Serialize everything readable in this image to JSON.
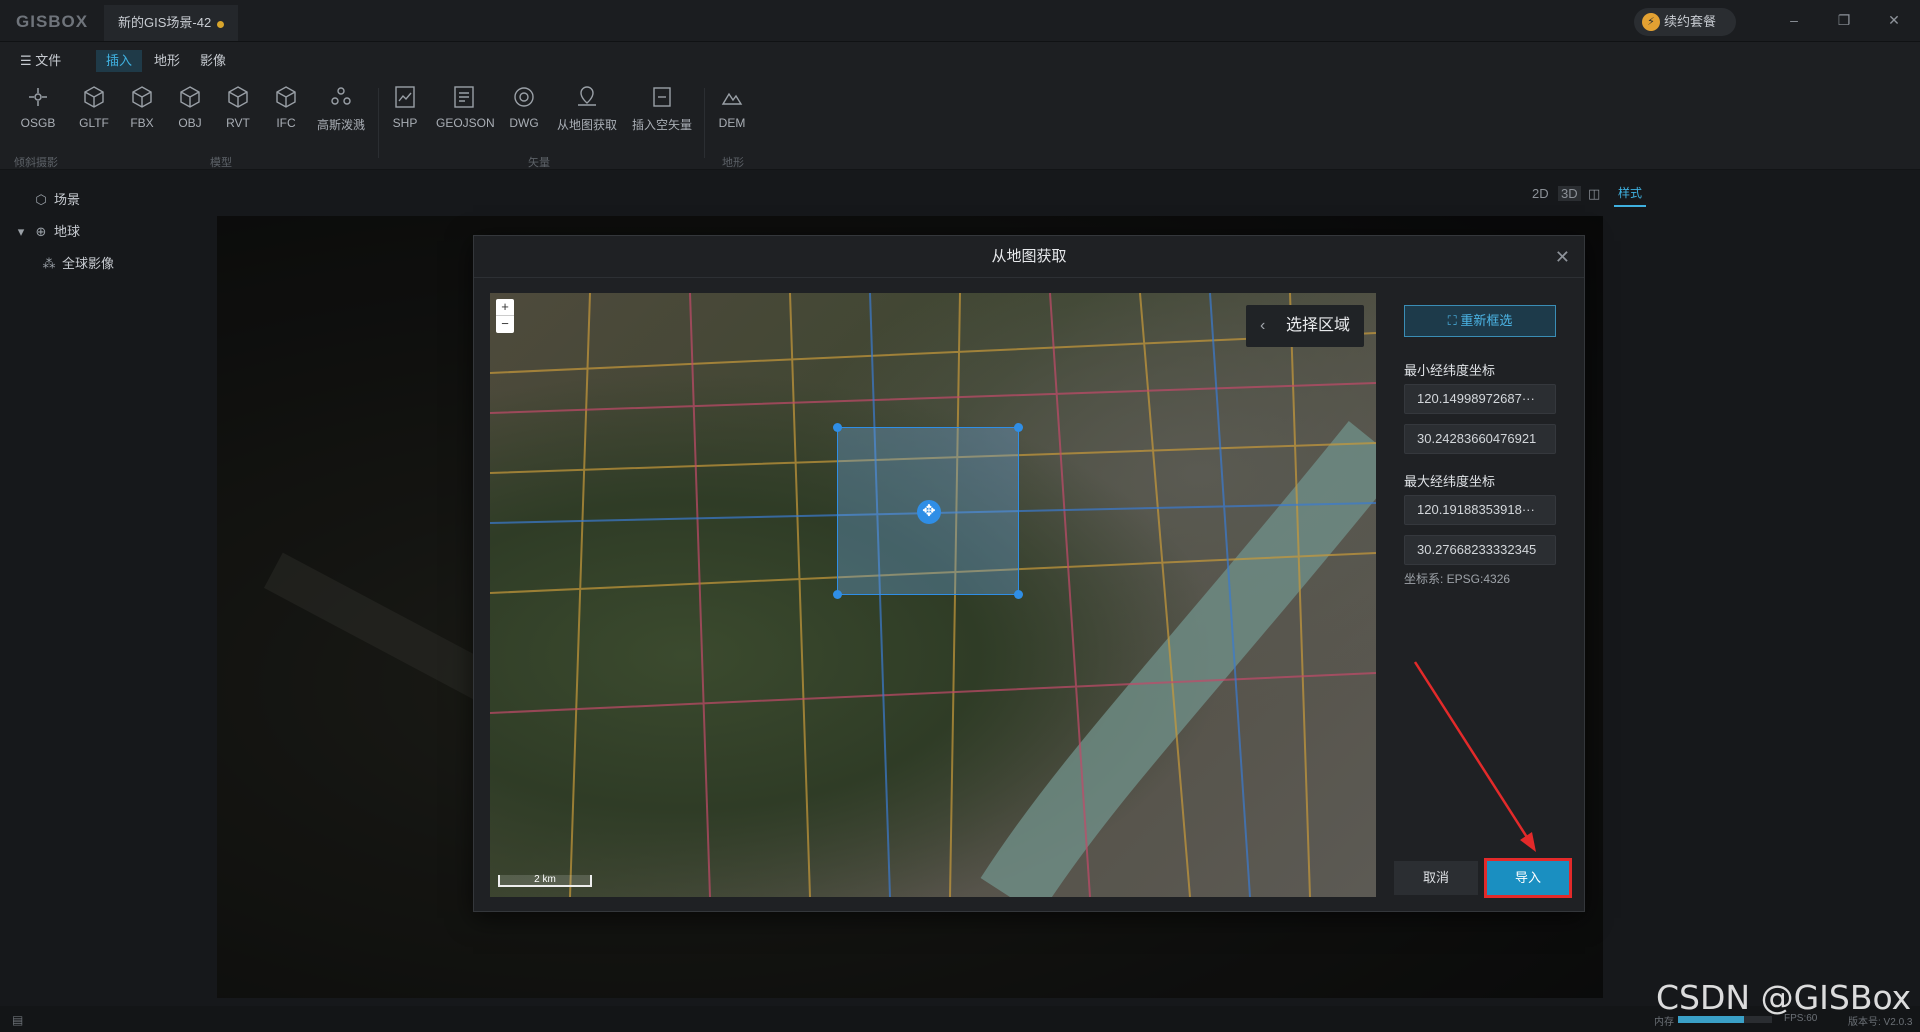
{
  "app": {
    "logo": "GISBOX",
    "doc_tab": "新的GIS场景-42",
    "renew_label": "续约套餐"
  },
  "window_controls": {
    "minimize": "–",
    "restore": "❐",
    "close": "✕"
  },
  "menu": {
    "file": "文件",
    "tabs": [
      "插入",
      "地形",
      "影像"
    ]
  },
  "ribbon": {
    "tools": [
      "OSGB",
      "GLTF",
      "FBX",
      "OBJ",
      "RVT",
      "IFC",
      "高斯泼溅",
      "SHP",
      "GEOJSON",
      "DWG",
      "从地图获取",
      "插入空矢量",
      "DEM"
    ],
    "groups": [
      "倾斜摄影",
      "模型",
      "矢量",
      "地形"
    ]
  },
  "tree": {
    "scene": "场景",
    "earth": "地球",
    "imagery": "全球影像"
  },
  "view": {
    "mode_2d": "2D",
    "mode_3d": "3D",
    "split": "◫",
    "style_tab": "样式"
  },
  "dialog": {
    "title": "从地图获取",
    "select_area": "选择区域",
    "reselect": "重新框选",
    "min_label": "最小经纬度坐标",
    "min_lon": "120.14998972687···",
    "min_lat": "30.24283660476921",
    "max_label": "最大经纬度坐标",
    "max_lon": "120.19188353918···",
    "max_lat": "30.27668233332345",
    "crs": "坐标系: EPSG:4326",
    "cancel": "取消",
    "import": "导入",
    "scale": "2 km",
    "zoom_in": "+",
    "zoom_out": "−"
  },
  "status": {
    "memory_label": "内存",
    "fps": "FPS:60",
    "version": "版本号: V2.0.3",
    "memory_fraction": 0.7
  },
  "watermark": "CSDN @GISBox",
  "colors": {
    "accent": "#3fb0df",
    "import_btn": "#1a8fc1",
    "highlight_border": "#e32a2a"
  }
}
